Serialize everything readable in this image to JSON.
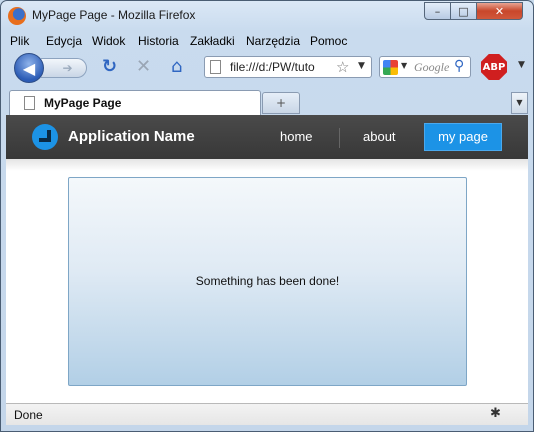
{
  "window": {
    "title": "MyPage Page - Mozilla Firefox",
    "min_glyph": "–",
    "max_glyph": "□",
    "close_glyph": "✕"
  },
  "menubar": {
    "items": [
      "Plik",
      "Edycja",
      "Widok",
      "Historia",
      "Zakładki",
      "Narzędzia",
      "Pomoc"
    ]
  },
  "navbar": {
    "url": "file:///d:/PW/tuto",
    "search_placeholder": "Google",
    "adblock_label": "ABP"
  },
  "tabs": {
    "active_title": "MyPage Page",
    "new_tab_glyph": "+"
  },
  "app": {
    "name": "Application Name",
    "nav": {
      "home": "home",
      "about": "about",
      "my_page": "my page"
    },
    "accent_color": "#1c93e6"
  },
  "main": {
    "message": "Something has been done!"
  },
  "status": {
    "text": "Done"
  }
}
